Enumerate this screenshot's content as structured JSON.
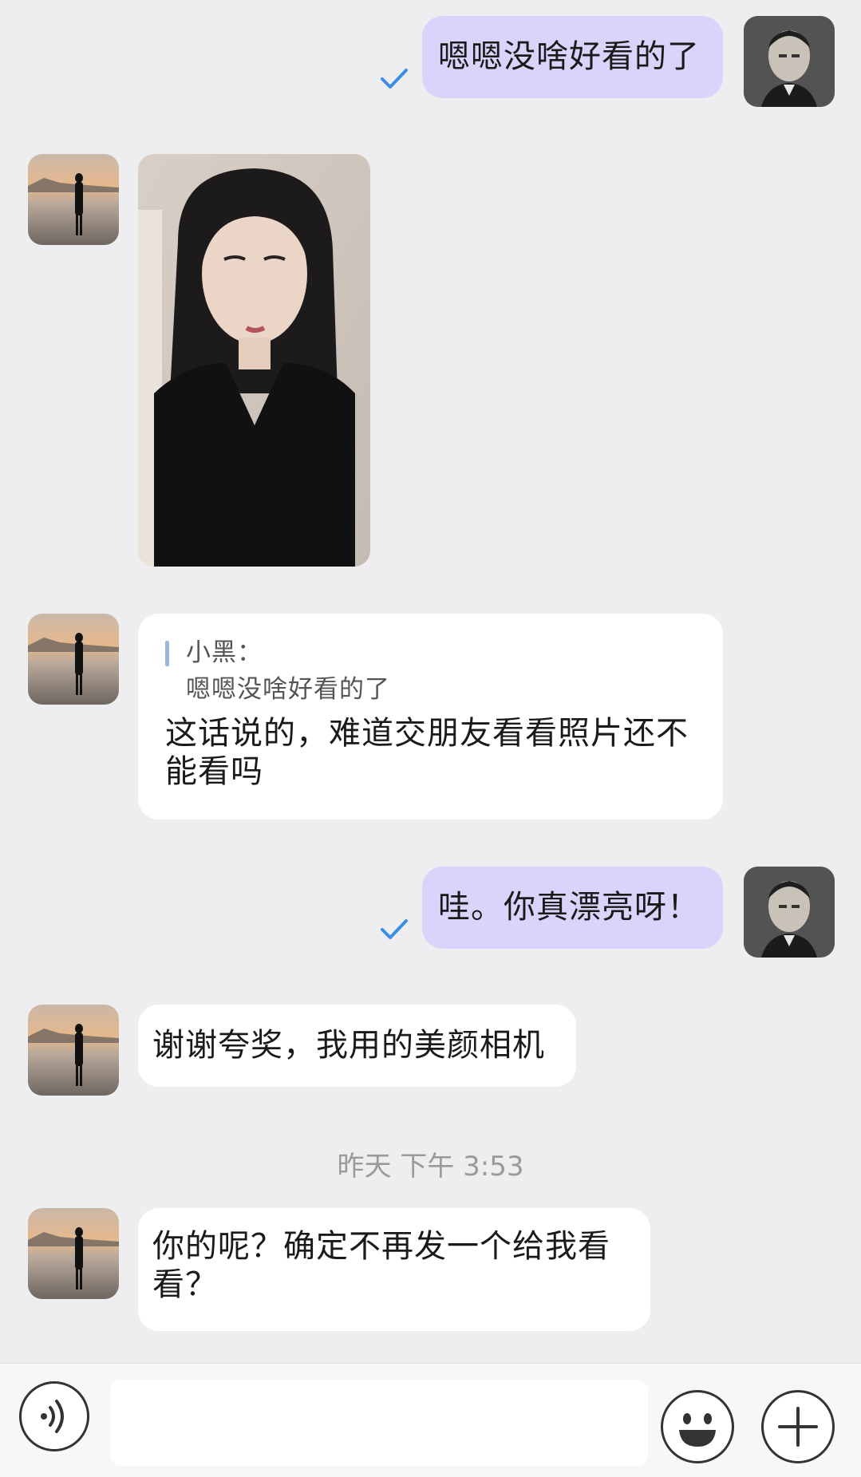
{
  "messages": [
    {
      "side": "out",
      "text": "嗯嗯没啥好看的了",
      "status": "read"
    },
    {
      "side": "in",
      "type": "image",
      "description_icon": "photo-of-woman"
    },
    {
      "side": "in",
      "quote": {
        "author": "小黑：",
        "text": "嗯嗯没啥好看的了"
      },
      "text_line1": "这话说的，难道交朋友看看照片还不",
      "text_line2": "能看吗"
    },
    {
      "side": "out",
      "text": "哇。你真漂亮呀！",
      "status": "read"
    },
    {
      "side": "in",
      "text": "谢谢夸奖，我用的美颜相机"
    },
    {
      "side": "in",
      "text_line1": "你的呢？确定不再发一个给我看",
      "text_line2": "看？"
    }
  ],
  "timestamp": "昨天 下午 3:53",
  "input": {
    "placeholder": "",
    "value": ""
  },
  "icons": {
    "voice": "voice-icon",
    "emoji": "emoji-icon",
    "plus": "plus-icon",
    "read": "checkmark-icon"
  },
  "colors": {
    "outgoing_bubble": "#dcd3fb",
    "incoming_bubble": "#ffffff",
    "background": "#eeeef0",
    "checkmark": "#3a8ee6"
  }
}
